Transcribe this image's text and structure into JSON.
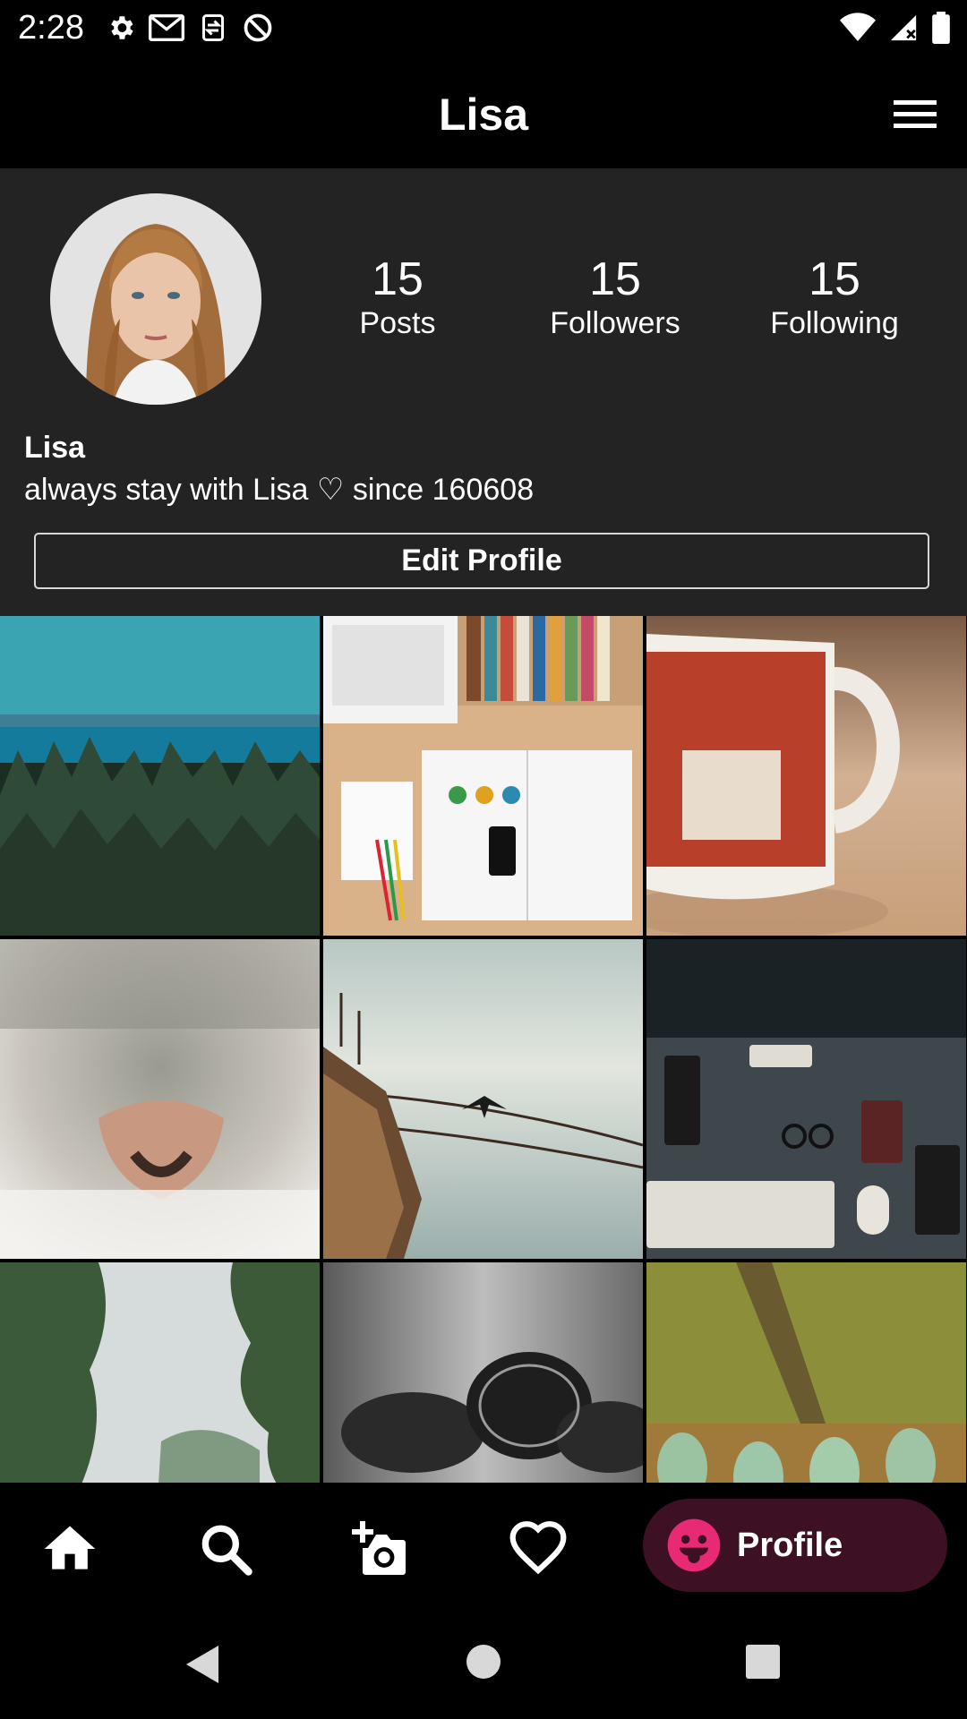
{
  "status_bar": {
    "time": "2:28",
    "icons_left": [
      "settings-icon",
      "gmail-icon",
      "sync-icon",
      "do-not-disturb-icon"
    ],
    "icons_right": [
      "wifi-icon",
      "signal-icon",
      "battery-icon"
    ]
  },
  "app_bar": {
    "title": "Lisa",
    "menu_icon": "hamburger-menu-icon"
  },
  "profile": {
    "stats": [
      {
        "value": "15",
        "label": "Posts"
      },
      {
        "value": "15",
        "label": "Followers"
      },
      {
        "value": "15",
        "label": "Following"
      }
    ],
    "name": "Lisa",
    "bio": "always stay with Lisa ♡ since 160608",
    "edit_button": "Edit Profile"
  },
  "posts": [
    "landscape-forest-sea",
    "desk-notebook-books",
    "coffee-mug",
    "cat-nose",
    "boat-bird-lake",
    "desk-keyboard-accessories",
    "trees-sky",
    "pine-cones",
    "glass-bottles"
  ],
  "bottom_nav": {
    "items": [
      "home-icon",
      "search-icon",
      "add-photo-icon",
      "heart-icon"
    ],
    "active_label": "Profile",
    "active_icon": "profile-face-icon",
    "accent_color": "#e82a74",
    "active_bg": "#3d1123"
  },
  "system_nav": [
    "back-icon",
    "home-circle-icon",
    "recents-icon"
  ]
}
